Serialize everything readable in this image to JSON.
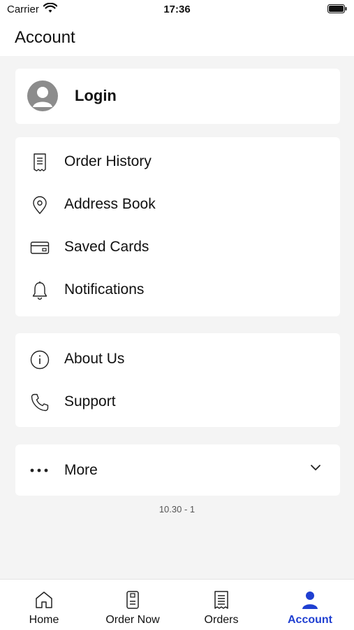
{
  "status_bar": {
    "carrier": "Carrier",
    "time": "17:36"
  },
  "header": {
    "title": "Account"
  },
  "login": {
    "label": "Login"
  },
  "menu_main": [
    {
      "label": "Order History",
      "icon": "receipt-icon"
    },
    {
      "label": "Address Book",
      "icon": "location-pin-icon"
    },
    {
      "label": "Saved Cards",
      "icon": "credit-card-icon"
    },
    {
      "label": "Notifications",
      "icon": "bell-icon"
    }
  ],
  "menu_info": [
    {
      "label": "About Us",
      "icon": "info-icon"
    },
    {
      "label": "Support",
      "icon": "phone-icon"
    }
  ],
  "more": {
    "label": "More",
    "icon": "more-dots-icon"
  },
  "version": "10.30 - 1",
  "tabbar": {
    "tabs": [
      {
        "label": "Home",
        "icon": "home-icon"
      },
      {
        "label": "Order Now",
        "icon": "order-now-icon"
      },
      {
        "label": "Orders",
        "icon": "orders-icon"
      },
      {
        "label": "Account",
        "icon": "account-icon",
        "active": true
      }
    ]
  },
  "colors": {
    "accent": "#1f3fd1",
    "background": "#f4f4f4",
    "card": "#ffffff",
    "avatar": "#8c8c8c"
  }
}
